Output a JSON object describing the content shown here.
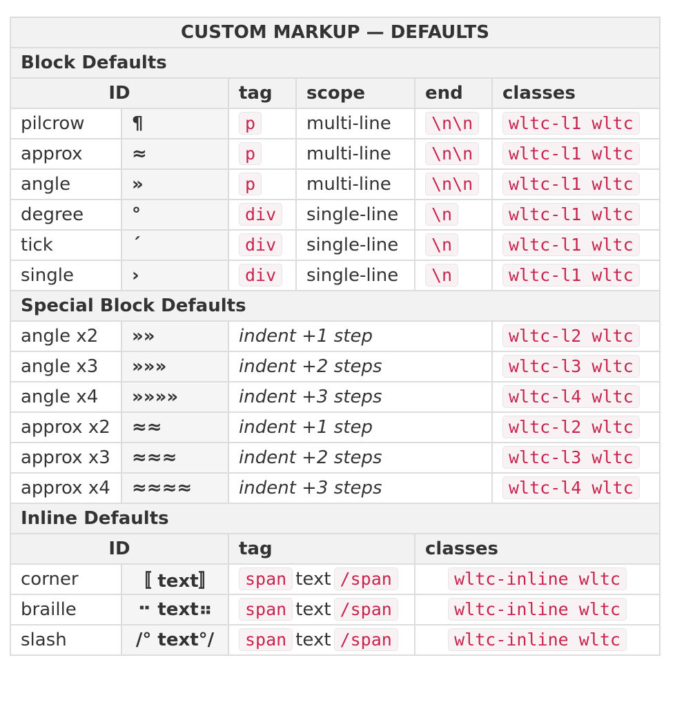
{
  "title": "CUSTOM MARKUP — DEFAULTS",
  "block": {
    "heading": "Block Defaults",
    "headers": {
      "id": "ID",
      "tag": "tag",
      "scope": "scope",
      "end": "end",
      "classes": "classes"
    },
    "rows": [
      {
        "name": "pilcrow",
        "symbol": "¶",
        "tag": "p",
        "scope": "multi-line",
        "end": "\\n\\n",
        "classes": "wltc-l1 wltc"
      },
      {
        "name": "approx",
        "symbol": "≈",
        "tag": "p",
        "scope": "multi-line",
        "end": "\\n\\n",
        "classes": "wltc-l1 wltc"
      },
      {
        "name": "angle",
        "symbol": "»",
        "tag": "p",
        "scope": "multi-line",
        "end": "\\n\\n",
        "classes": "wltc-l1 wltc"
      },
      {
        "name": "degree",
        "symbol": "°",
        "tag": "div",
        "scope": "single-line",
        "end": "\\n",
        "classes": "wltc-l1 wltc"
      },
      {
        "name": "tick",
        "symbol": "´",
        "tag": "div",
        "scope": "single-line",
        "end": "\\n",
        "classes": "wltc-l1 wltc"
      },
      {
        "name": "single",
        "symbol": "›",
        "tag": "div",
        "scope": "single-line",
        "end": "\\n",
        "classes": "wltc-l1 wltc"
      }
    ]
  },
  "special": {
    "heading": "Special Block Defaults",
    "rows": [
      {
        "name": "angle x2",
        "symbol": "»»",
        "desc": "indent +1 step",
        "classes": "wltc-l2 wltc"
      },
      {
        "name": "angle x3",
        "symbol": "»»»",
        "desc": "indent +2 steps",
        "classes": "wltc-l3 wltc"
      },
      {
        "name": "angle x4",
        "symbol": "»»»»",
        "desc": "indent +3 steps",
        "classes": "wltc-l4 wltc"
      },
      {
        "name": "approx x2",
        "symbol": "≈≈",
        "desc": "indent +1 step",
        "classes": "wltc-l2 wltc"
      },
      {
        "name": "approx x3",
        "symbol": "≈≈≈",
        "desc": "indent +2 steps",
        "classes": "wltc-l3 wltc"
      },
      {
        "name": "approx x4",
        "symbol": "≈≈≈≈",
        "desc": "indent +3 steps",
        "classes": "wltc-l4 wltc"
      }
    ]
  },
  "inline": {
    "heading": "Inline Defaults",
    "headers": {
      "id": "ID",
      "tag": "tag",
      "classes": "classes"
    },
    "rows": [
      {
        "name": "corner",
        "symbol": "〚 text〛",
        "open": "span",
        "text": "text",
        "close": "/span",
        "classes": "wltc-inline wltc"
      },
      {
        "name": "braille",
        "symbol": "⠒ text⠶",
        "open": "span",
        "text": "text",
        "close": "/span",
        "classes": "wltc-inline wltc"
      },
      {
        "name": "slash",
        "symbol": "/° text°/",
        "open": "span",
        "text": "text",
        "close": "/span",
        "classes": "wltc-inline wltc"
      }
    ]
  }
}
